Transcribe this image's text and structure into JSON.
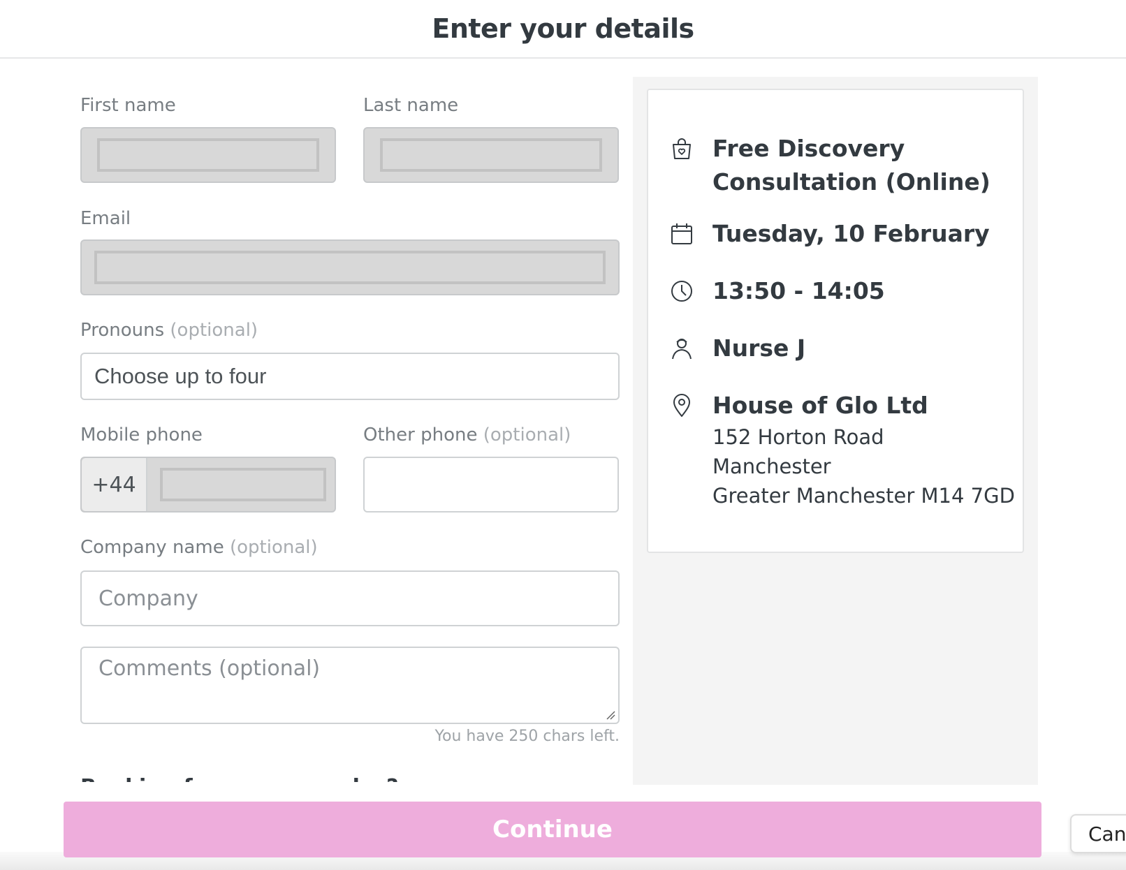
{
  "header": {
    "title": "Enter your details"
  },
  "form": {
    "first_name_label": "First name",
    "last_name_label": "Last name",
    "email_label": "Email",
    "pronouns_label": "Pronouns",
    "pronouns_optional": "(optional)",
    "pronouns_placeholder": "Choose up to four",
    "mobile_label": "Mobile phone",
    "mobile_prefix": "+44",
    "other_phone_label": "Other phone",
    "other_phone_optional": "(optional)",
    "company_label": "Company name",
    "company_optional": "(optional)",
    "company_placeholder": "Company",
    "comments_placeholder": "Comments (optional)",
    "chars_left": "You have 250 chars left.",
    "booking_heading": "Booking for someone else?"
  },
  "summary": {
    "service": "Free Discovery Consultation (Online)",
    "service_line1": "Free Discovery",
    "service_line2": "Consultation (Online)",
    "date": "Tuesday, 10 February",
    "time": "13:50 - 14:05",
    "staff": "Nurse J",
    "location_name": "House of Glo Ltd",
    "address_line1": "152 Horton Road",
    "address_line2": "Manchester",
    "address_line3": "Greater Manchester M14 7GD"
  },
  "icons": {
    "service": "shopping-bag-heart-icon",
    "date": "calendar-icon",
    "time": "clock-icon",
    "staff": "person-icon",
    "location": "map-pin-icon"
  },
  "footer": {
    "continue_label": "Continue",
    "cancel_label": "Cancel"
  },
  "colors": {
    "accent": "#eeaddc",
    "text": "#333a40",
    "muted": "#777d82"
  }
}
